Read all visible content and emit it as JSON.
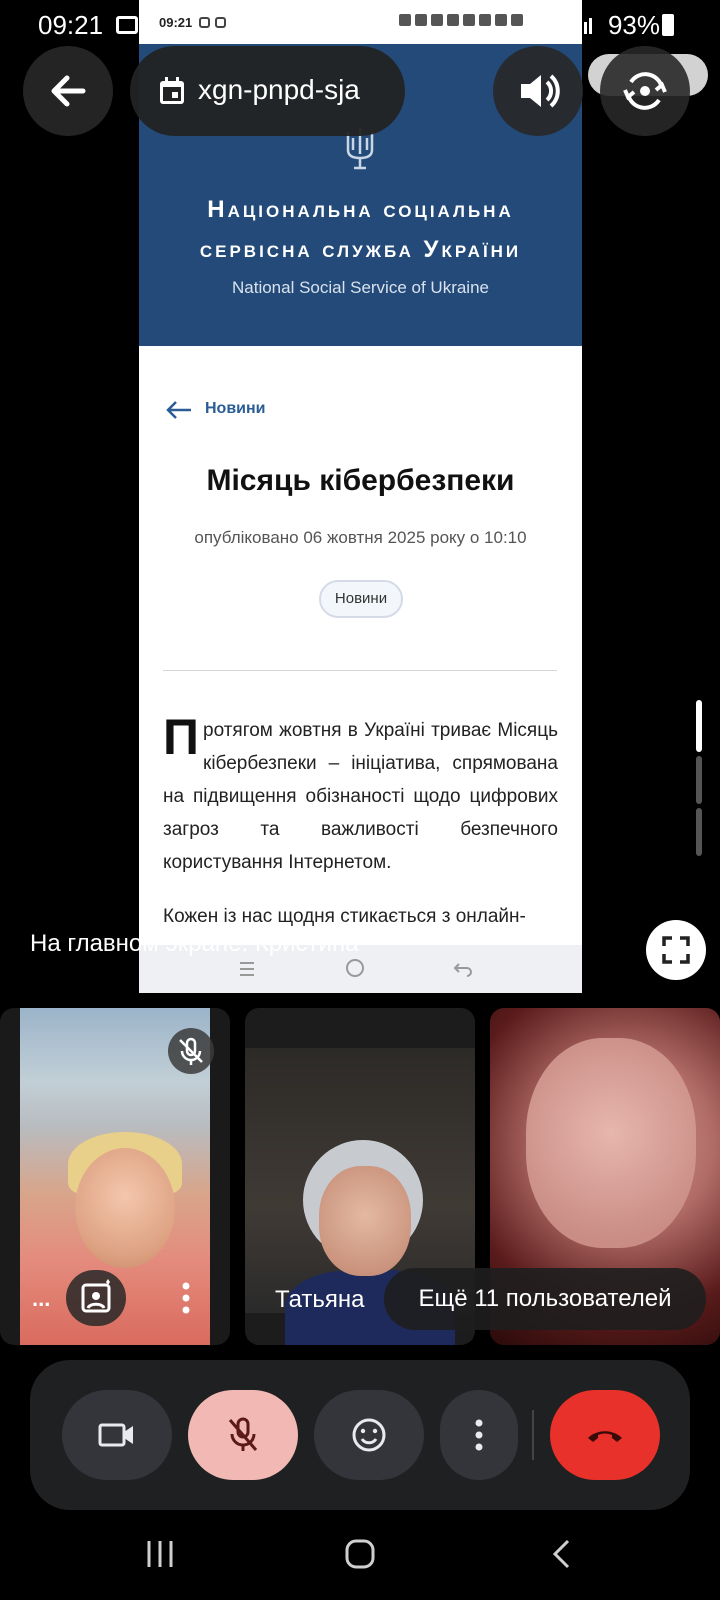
{
  "status_bar": {
    "time": "09:21",
    "battery": "93%"
  },
  "shared_screen": {
    "inner_time": "09:21",
    "org_name_line1": "Національна соціальна",
    "org_name_line2": "сервісна служба України",
    "org_name_en": "National Social Service of Ukraine",
    "back_link": "Новини",
    "article_title": "Місяць кібербезпеки",
    "published": "опубліковано 06 жовтня 2025 року о 10:10",
    "tag": "Новини",
    "dropcap": "П",
    "paragraph1": "ротягом жовтня в Україні триває Місяць кібербезпеки – ініціатива, спрямована на підвищення обізнаності щодо цифрових загроз та важливості безпечного користування Інтернетом.",
    "paragraph2": "Кожен із нас щодня стикається з онлайн-"
  },
  "meeting": {
    "code": "xgn-pnpd-sja",
    "main_screen_label": "На главном экране: Кристина"
  },
  "participants": {
    "self_label": "...",
    "tile2_name": "Татьяна",
    "more_users": "Ещё 11 пользователей"
  },
  "colors": {
    "end_call": "#e8312a",
    "mic_muted_bg": "#f1b8b4",
    "hero_bg": "#234a78"
  }
}
